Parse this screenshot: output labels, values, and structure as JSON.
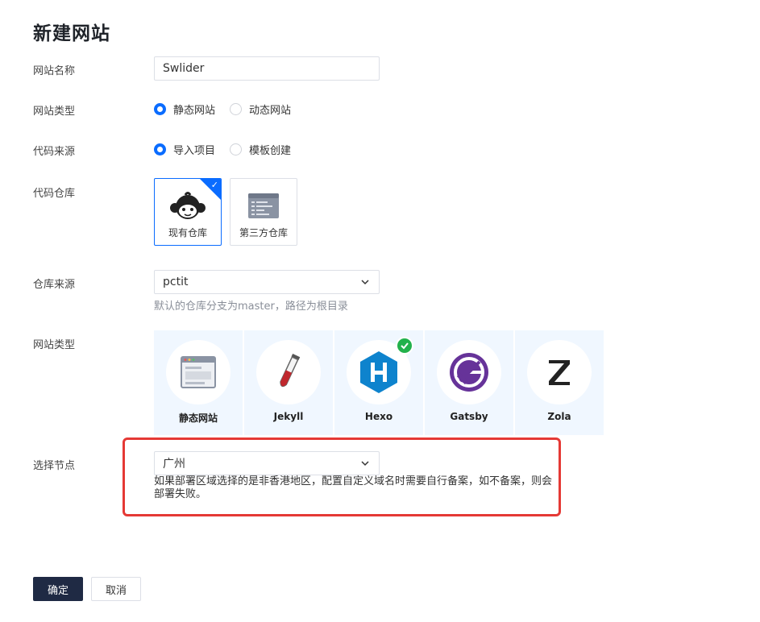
{
  "page": {
    "title": "新建网站"
  },
  "fields": {
    "site_name": {
      "label": "网站名称",
      "value": "Swlider"
    },
    "site_type": {
      "label": "网站类型",
      "options": [
        "静态网站",
        "动态网站"
      ],
      "selected": "静态网站"
    },
    "code_source": {
      "label": "代码来源",
      "options": [
        "导入项目",
        "模板创建"
      ],
      "selected": "导入项目"
    },
    "code_repo": {
      "label": "代码仓库",
      "cards": [
        "现有仓库",
        "第三方仓库"
      ],
      "selected": "现有仓库"
    },
    "repo_source": {
      "label": "仓库来源",
      "value": "pctit",
      "hint": "默认的仓库分支为master，路径为根目录"
    },
    "framework": {
      "label": "网站类型",
      "items": [
        "静态网站",
        "Jekyll",
        "Hexo",
        "Gatsby",
        "Zola"
      ],
      "selected": "Hexo"
    },
    "node": {
      "label": "选择节点",
      "value": "广州",
      "warning": "如果部署区域选择的是非香港地区，配置自定义域名时需要自行备案，如不备案，则会部署失败。"
    }
  },
  "actions": {
    "confirm": "确定",
    "cancel": "取消"
  },
  "colors": {
    "primary": "#0a6cff",
    "dark_button": "#1f2a44",
    "highlight": "#e53935",
    "success": "#22b14c",
    "card_bg": "#f0f7ff"
  },
  "icons": {
    "existing_repo": "monkey-logo-icon",
    "third_party_repo": "code-window-icon",
    "static_site": "browser-window-icon",
    "jekyll": "test-tube-icon",
    "hexo": "hexagon-h-icon",
    "gatsby": "gatsby-logo-icon",
    "zola": "zola-z-icon",
    "selected_check": "check-icon"
  }
}
